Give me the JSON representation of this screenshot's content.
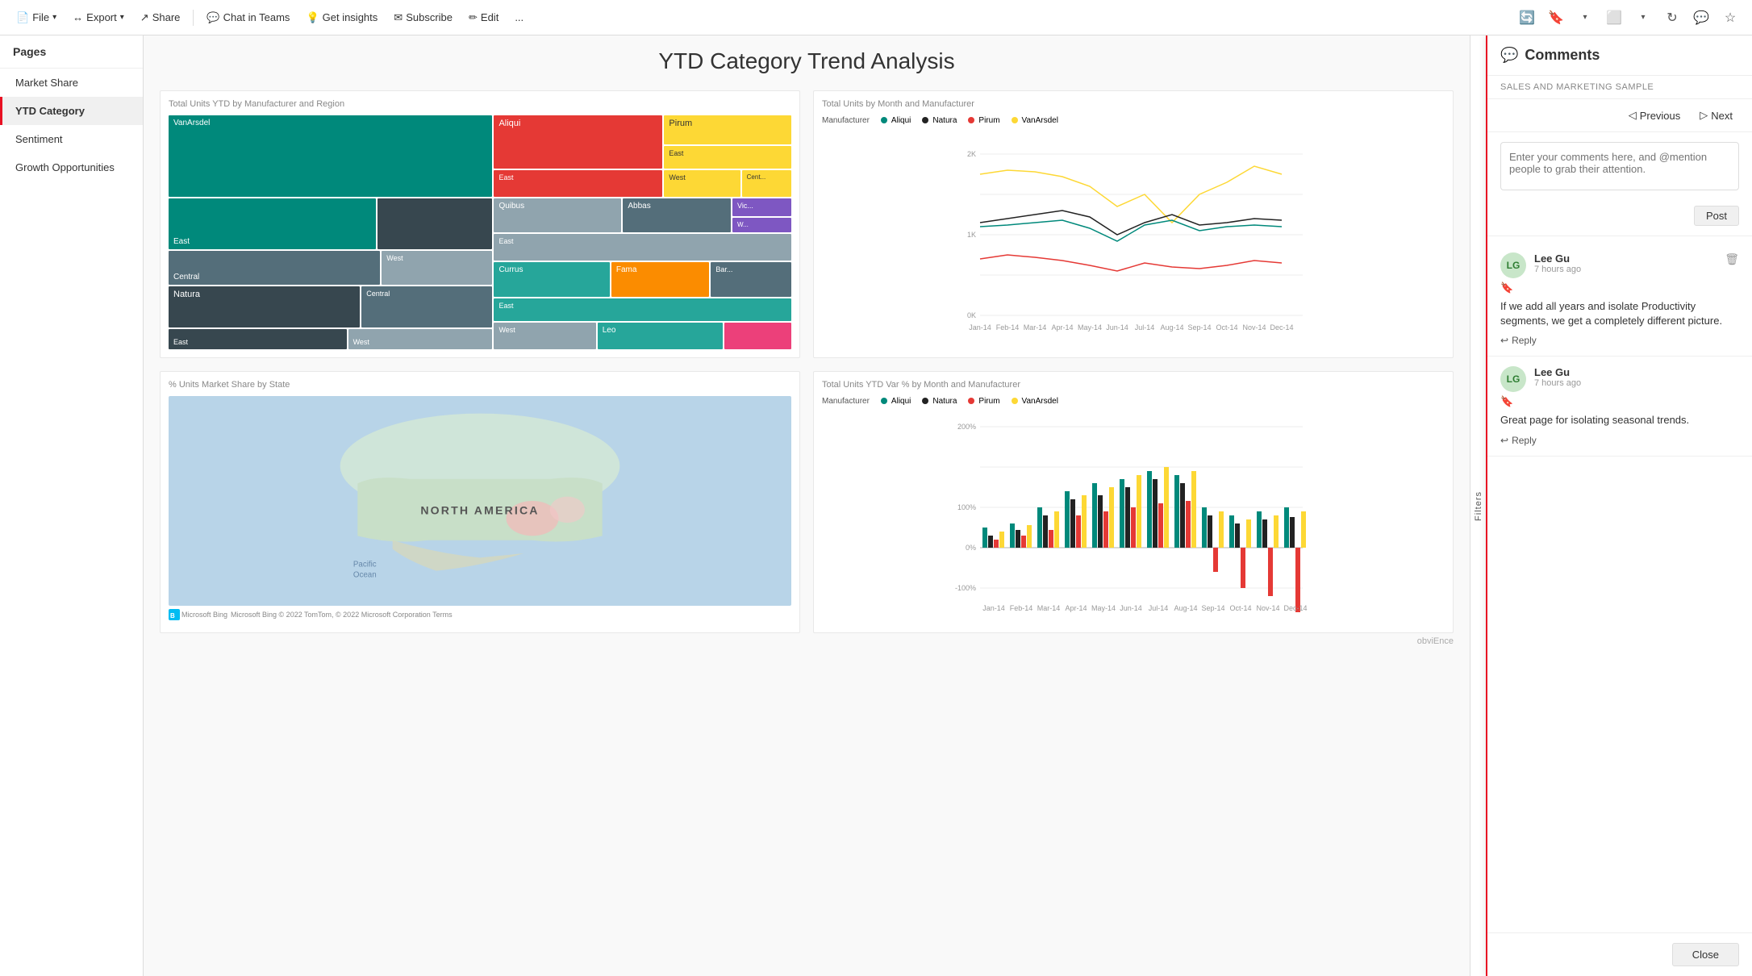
{
  "toolbar": {
    "file_label": "File",
    "export_label": "Export",
    "share_label": "Share",
    "chat_in_teams_label": "Chat in Teams",
    "get_insights_label": "Get insights",
    "subscribe_label": "Subscribe",
    "edit_label": "Edit",
    "more_label": "..."
  },
  "sidebar": {
    "header": "Pages",
    "items": [
      {
        "label": "Market Share",
        "active": false
      },
      {
        "label": "YTD Category",
        "active": true
      },
      {
        "label": "Sentiment",
        "active": false
      },
      {
        "label": "Growth Opportunities",
        "active": false
      }
    ]
  },
  "page": {
    "title": "YTD Category Trend Analysis",
    "chart1_title": "Total Units YTD by Manufacturer and Region",
    "chart2_title": "Total Units by Month and Manufacturer",
    "chart3_title": "% Units Market Share by State",
    "chart4_title": "Total Units YTD Var % by Month and Manufacturer",
    "map_label": "NORTH AMERICA",
    "map_ocean_label": "Pacific\nOcean",
    "map_credit": "Microsoft Bing    © 2022 TomTom, © 2022 Microsoft Corporation  Terms",
    "watermark": "obviEnce",
    "legend_manufacturers": [
      "Aliqui",
      "Natura",
      "Pirum",
      "VanArsdel"
    ],
    "legend_colors": [
      "#00897b",
      "#333333",
      "#e53935",
      "#fdd835"
    ],
    "months": [
      "Jan-14",
      "Feb-14",
      "Mar-14",
      "Apr-14",
      "May-14",
      "Jun-14",
      "Jul-14",
      "Aug-14",
      "Sep-14",
      "Oct-14",
      "Nov-14",
      "Dec-14"
    ],
    "filters_label": "Filters"
  },
  "comments": {
    "title": "Comments",
    "subtitle": "SALES AND MARKETING SAMPLE",
    "nav_previous": "Previous",
    "nav_next": "Next",
    "input_placeholder": "Enter your comments here, and @mention people to grab their attention.",
    "post_label": "Post",
    "close_label": "Close",
    "items": [
      {
        "author": "Lee Gu",
        "avatar_initials": "LG",
        "time": "7 hours ago",
        "body": "If we add all years and isolate Productivity segments, we get a completely different picture.",
        "reply_label": "Reply"
      },
      {
        "author": "Lee Gu",
        "avatar_initials": "LG",
        "time": "7 hours ago",
        "body": "Great page for isolating seasonal trends.",
        "reply_label": "Reply"
      }
    ]
  }
}
